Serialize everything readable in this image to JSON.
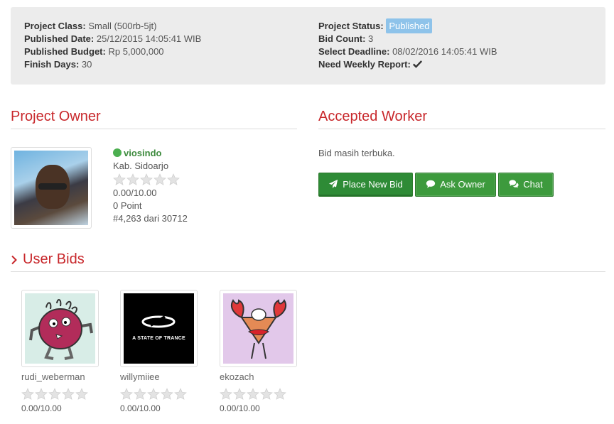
{
  "project": {
    "class_label": "Project Class:",
    "class_value": "Small (500rb-5jt)",
    "published_date_label": "Published Date:",
    "published_date_value": "25/12/2015 14:05:41 WIB",
    "budget_label": "Published Budget:",
    "budget_value": "Rp 5,000,000",
    "finish_days_label": "Finish Days:",
    "finish_days_value": "30",
    "status_label": "Project Status:",
    "status_value": "Published",
    "bid_count_label": "Bid Count:",
    "bid_count_value": "3",
    "deadline_label": "Select Deadline:",
    "deadline_value": "08/02/2016 14:05:41 WIB",
    "weekly_report_label": "Need Weekly Report:",
    "weekly_report_icon": "check-icon"
  },
  "owner_section": {
    "title": "Project Owner",
    "name": "viosindo",
    "location": "Kab. Sidoarjo",
    "rating": "0.00/10.00",
    "points": "0 Point",
    "rank": "#4,263 dari 30712",
    "status": "online",
    "stars_filled": 0
  },
  "worker_section": {
    "title": "Accepted Worker",
    "message": "Bid masih terbuka.",
    "buttons": [
      {
        "label": "Place New Bid",
        "icon": "paper-plane-icon"
      },
      {
        "label": "Ask Owner",
        "icon": "comment-icon"
      },
      {
        "label": "Chat",
        "icon": "comments-icon"
      }
    ]
  },
  "bids_section": {
    "title": "User Bids",
    "bidders": [
      {
        "name": "rudi_weberman",
        "rating": "0.00/10.00",
        "stars_filled": 0
      },
      {
        "name": "willymiiee",
        "rating": "0.00/10.00",
        "stars_filled": 0,
        "avatar_text": "A STATE OF TRANCE"
      },
      {
        "name": "ekozach",
        "rating": "0.00/10.00",
        "stars_filled": 0
      }
    ]
  },
  "colors": {
    "accent": "#c8272b",
    "button_green": "#3d9a3d",
    "status_badge": "#8ec3ea",
    "online": "#4caf50"
  }
}
